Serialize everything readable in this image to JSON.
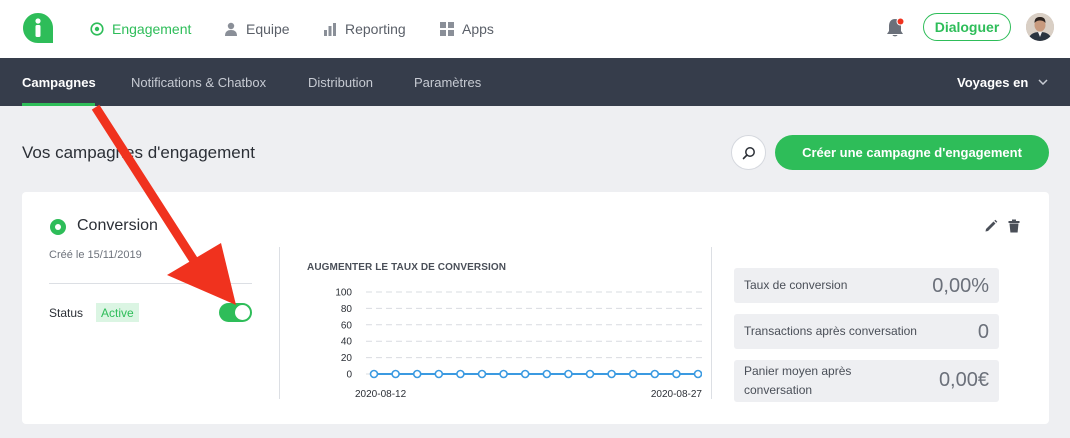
{
  "topnav": {
    "items": [
      {
        "label": "Engagement",
        "icon": "target-icon",
        "active": true
      },
      {
        "label": "Equipe",
        "icon": "user-icon",
        "active": false
      },
      {
        "label": "Reporting",
        "icon": "bar-chart-icon",
        "active": false
      },
      {
        "label": "Apps",
        "icon": "grid-icon",
        "active": false
      }
    ],
    "dialog_label": "Dialoguer"
  },
  "subnav": {
    "items": [
      {
        "label": "Campagnes",
        "active": true
      },
      {
        "label": "Notifications & Chatbox",
        "active": false
      },
      {
        "label": "Distribution",
        "active": false
      },
      {
        "label": "Paramètres",
        "active": false
      }
    ],
    "site_selector": "Voyages en"
  },
  "page": {
    "title": "Vos campagnes d'engagement",
    "create_label": "Créer une campagne d'engagement"
  },
  "campaign": {
    "name": "Conversion",
    "created": "Créé le 15/11/2019",
    "status_label": "Status",
    "status_value": "Active",
    "toggle_on": true
  },
  "chart_data": {
    "type": "line",
    "title": "AUGMENTER LE TAUX DE CONVERSION",
    "x_labels": [
      "2020-08-12",
      "2020-08-27"
    ],
    "x": [
      "2020-08-12",
      "2020-08-13",
      "2020-08-14",
      "2020-08-15",
      "2020-08-16",
      "2020-08-17",
      "2020-08-18",
      "2020-08-19",
      "2020-08-20",
      "2020-08-21",
      "2020-08-22",
      "2020-08-23",
      "2020-08-24",
      "2020-08-25",
      "2020-08-26",
      "2020-08-27"
    ],
    "series": [
      {
        "values": [
          0,
          0,
          0,
          0,
          0,
          0,
          0,
          0,
          0,
          0,
          0,
          0,
          0,
          0,
          0,
          0
        ]
      }
    ],
    "yticks": [
      0,
      20,
      40,
      60,
      80,
      100
    ],
    "ylim": [
      0,
      100
    ],
    "grid": true,
    "color": "#3b9ae1"
  },
  "stats": [
    {
      "label": "Taux de conversion",
      "value": "0,00%"
    },
    {
      "label": "Transactions après conversation",
      "value": "0"
    },
    {
      "label": "Panier moyen après conversation",
      "value": "0,00€"
    }
  ],
  "colors": {
    "accent": "#2ebd59",
    "subnav_bg": "#363d4b",
    "annotation": "#f0321e"
  }
}
